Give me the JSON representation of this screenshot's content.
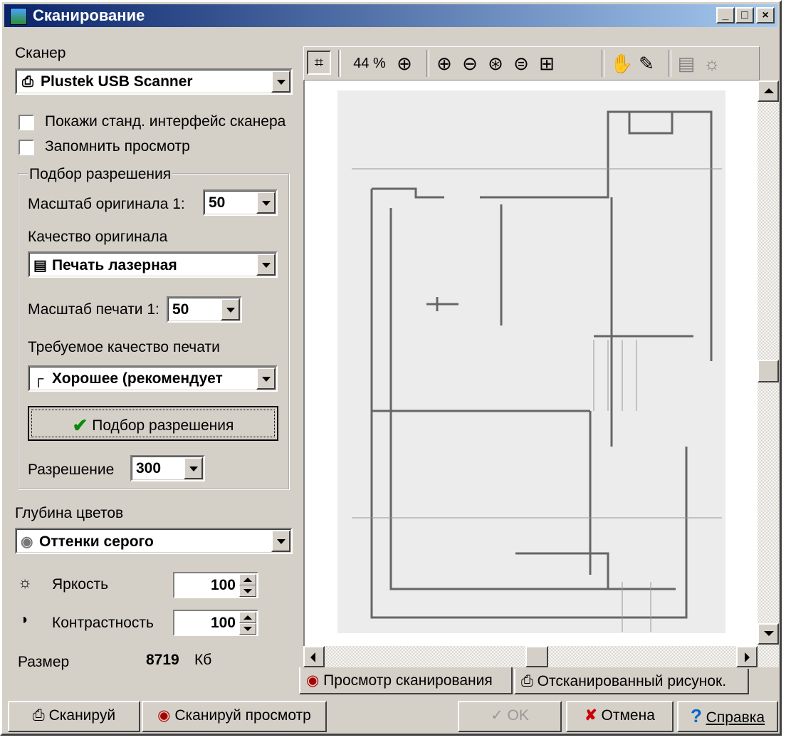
{
  "window": {
    "title": "Сканирование"
  },
  "scanner": {
    "label": "Сканер",
    "selected": "Plustek USB Scanner",
    "show_std_ui": "Покажи станд. интерфейс сканера",
    "remember_preview": "Запомнить просмотр"
  },
  "resolution_group": {
    "title": "Подбор разрешения",
    "orig_scale_label": "Масштаб оригинала 1:",
    "orig_scale_value": "50",
    "orig_quality_label": "Качество оригинала",
    "orig_quality_value": "Печать лазерная",
    "print_scale_label": "Масштаб печати 1:",
    "print_scale_value": "50",
    "print_quality_label": "Требуемое качество печати",
    "print_quality_value": "Хорошее (рекомендует",
    "fit_button": "Подбор разрешения",
    "resolution_label": "Разрешение",
    "resolution_value": "300"
  },
  "color": {
    "label": "Глубина цветов",
    "value": "Оттенки серого",
    "brightness_label": "Яркость",
    "brightness_value": "100",
    "contrast_label": "Контрастность",
    "contrast_value": "100",
    "size_label": "Размер",
    "size_value": "8719",
    "size_unit": "Кб"
  },
  "toolbar": {
    "zoom": "44 %"
  },
  "tabs": [
    "Просмотр сканирования",
    "Отсканированный рисунок."
  ],
  "buttons": {
    "scan": "Сканируй",
    "scan_preview": "Сканируй просмотр",
    "ok": "OK",
    "cancel": "Отмена",
    "help": "Справка"
  }
}
